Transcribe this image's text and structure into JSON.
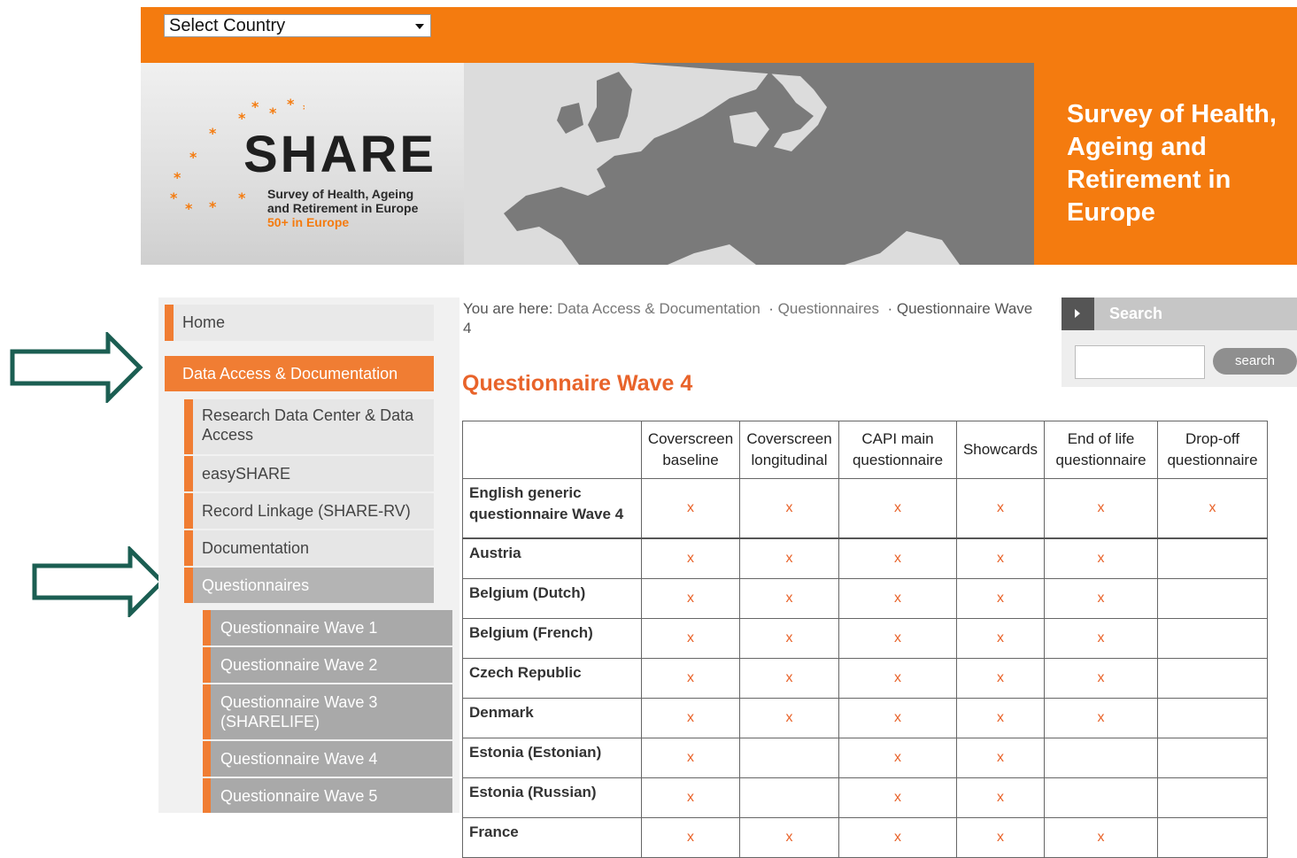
{
  "header": {
    "country_select": "Select Country"
  },
  "banner": {
    "logo_word": "SHARE",
    "logo_sub_line1": "Survey of Health, Ageing",
    "logo_sub_line2": "and Retirement in Europe",
    "logo_sub_line3": "50+ in Europe",
    "tagline": "Survey of Health, Ageing and Retirement in Europe"
  },
  "sidebar": {
    "home": "Home",
    "data_access": "Data Access & Documentation",
    "sub_items": [
      "Research Data Center & Data Access",
      "easySHARE",
      "Record Linkage (SHARE-RV)",
      "Documentation",
      "Questionnaires"
    ],
    "questionnaire_items": [
      "Questionnaire Wave 1",
      "Questionnaire Wave 2",
      "Questionnaire Wave 3 (SHARELIFE)",
      "Questionnaire Wave 4",
      "Questionnaire Wave 5"
    ]
  },
  "breadcrumb": {
    "prefix": "You are here:",
    "items": [
      "Data Access & Documentation",
      "Questionnaires",
      "Questionnaire Wave 4"
    ],
    "separator": "·"
  },
  "page_title": "Questionnaire Wave 4",
  "search": {
    "title": "Search",
    "button": "search",
    "value": ""
  },
  "table": {
    "headers": [
      "Coverscreen baseline",
      "Coverscreen longitudinal",
      "CAPI main questionnaire",
      "Showcards",
      "End of life questionnaire",
      "Drop-off questionnaire"
    ],
    "mark_symbol": "x",
    "rows": [
      {
        "label": "English generic questionnaire Wave 4",
        "marks": [
          1,
          1,
          1,
          1,
          1,
          1
        ]
      },
      {
        "label": "Austria",
        "marks": [
          1,
          1,
          1,
          1,
          1,
          0
        ]
      },
      {
        "label": "Belgium (Dutch)",
        "marks": [
          1,
          1,
          1,
          1,
          1,
          0
        ]
      },
      {
        "label": "Belgium (French)",
        "marks": [
          1,
          1,
          1,
          1,
          1,
          0
        ]
      },
      {
        "label": "Czech Republic",
        "marks": [
          1,
          1,
          1,
          1,
          1,
          0
        ]
      },
      {
        "label": "Denmark",
        "marks": [
          1,
          1,
          1,
          1,
          1,
          0
        ]
      },
      {
        "label": "Estonia (Estonian)",
        "marks": [
          1,
          0,
          1,
          1,
          0,
          0
        ]
      },
      {
        "label": "Estonia (Russian)",
        "marks": [
          1,
          0,
          1,
          1,
          0,
          0
        ]
      },
      {
        "label": "France",
        "marks": [
          1,
          1,
          1,
          1,
          1,
          0
        ]
      }
    ]
  },
  "colors": {
    "brand_orange": "#f47b0f",
    "accent_orange": "#e8632a",
    "arrow_green": "#1b5e52"
  }
}
